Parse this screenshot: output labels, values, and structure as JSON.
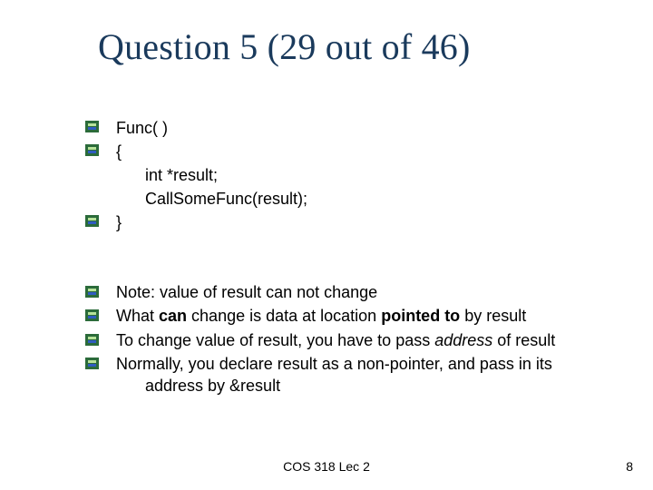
{
  "title": "Question 5 (29 out of 46)",
  "code": {
    "l1": "Func( )",
    "l2": "{",
    "l3": "int *result;",
    "l4": "CallSomeFunc(result);",
    "l5": "}"
  },
  "notes": {
    "n1a": "Note: value of result can not change",
    "n2a": "What ",
    "n2b": "can",
    "n2c": " change is data at location ",
    "n2d": "pointed to",
    "n2e": " by result",
    "n3a": "To change value of result, you have to pass ",
    "n3b": "address",
    "n3c": " of result",
    "n4a": "Normally, you declare result as a non-pointer, and pass in its",
    "n4b": "address by &result"
  },
  "footer": {
    "center": "COS 318 Lec 2",
    "page": "8"
  },
  "colors": {
    "title": "#1a3a5c"
  }
}
